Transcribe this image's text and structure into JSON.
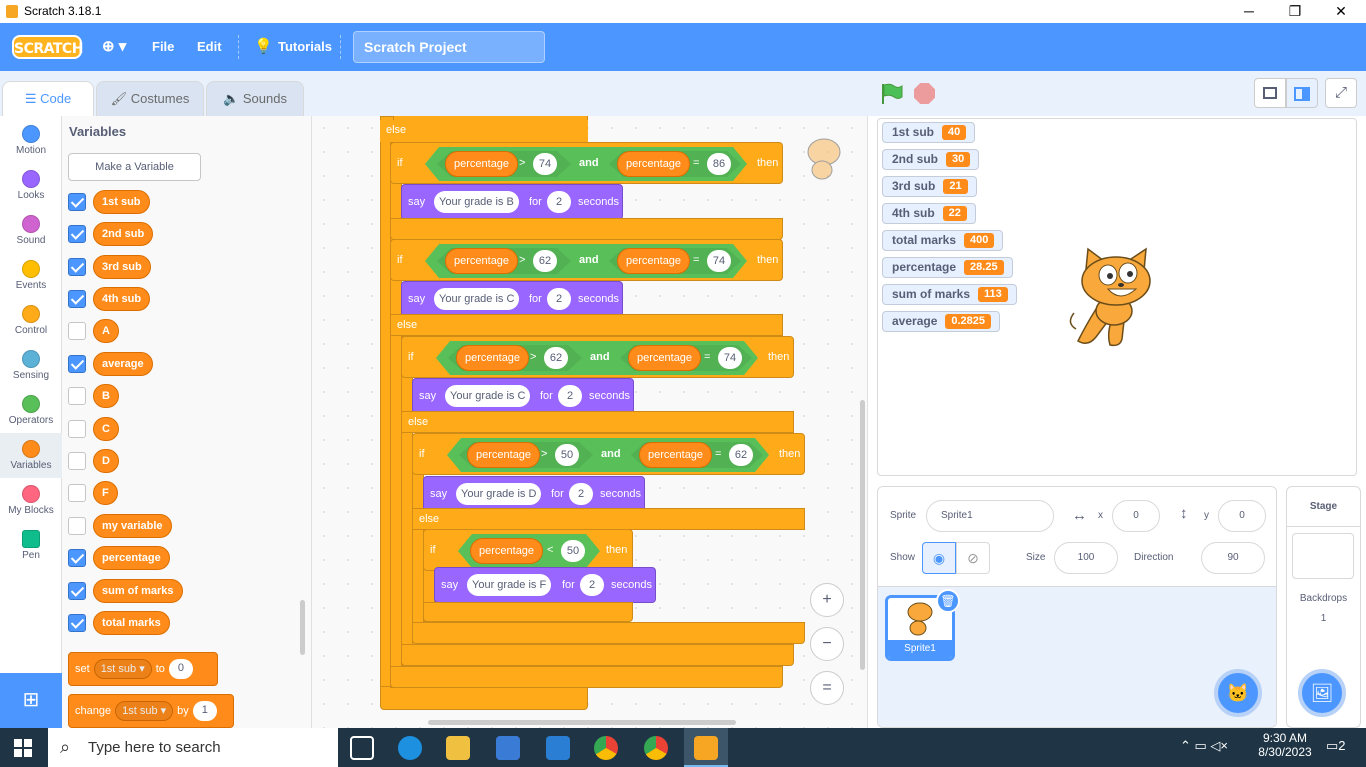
{
  "window": {
    "title": "Scratch 3.18.1",
    "min": "─",
    "max": "❐",
    "close": "✕"
  },
  "menu": {
    "logo": "SCRATCH",
    "language": "⊕ ▾",
    "file": "File",
    "edit": "Edit",
    "tutorials": "Tutorials",
    "project_title": "Scratch Project"
  },
  "tabs": [
    {
      "label": "Code",
      "icon": "code-icon"
    },
    {
      "label": "Costumes",
      "icon": "brush-icon"
    },
    {
      "label": "Sounds",
      "icon": "speaker-icon"
    }
  ],
  "categories": [
    {
      "label": "Motion",
      "color": "#4c97ff"
    },
    {
      "label": "Looks",
      "color": "#9966ff"
    },
    {
      "label": "Sound",
      "color": "#cf63cf"
    },
    {
      "label": "Events",
      "color": "#ffbf00"
    },
    {
      "label": "Control",
      "color": "#ffab19"
    },
    {
      "label": "Sensing",
      "color": "#5cb1d6"
    },
    {
      "label": "Operators",
      "color": "#59c059"
    },
    {
      "label": "Variables",
      "color": "#ff8c1a"
    },
    {
      "label": "My Blocks",
      "color": "#ff6680"
    },
    {
      "label": "Pen",
      "color": "#0fbd8c"
    }
  ],
  "palette": {
    "title": "Variables",
    "make_variable": "Make a Variable",
    "variables": [
      {
        "name": "1st sub",
        "checked": true
      },
      {
        "name": "2nd sub",
        "checked": true
      },
      {
        "name": "3rd sub",
        "checked": true
      },
      {
        "name": "4th sub",
        "checked": true
      },
      {
        "name": "A",
        "checked": false
      },
      {
        "name": "average",
        "checked": true
      },
      {
        "name": "B",
        "checked": false
      },
      {
        "name": "C",
        "checked": false
      },
      {
        "name": "D",
        "checked": false
      },
      {
        "name": "F",
        "checked": false
      },
      {
        "name": "my variable",
        "checked": false
      },
      {
        "name": "percentage",
        "checked": true
      },
      {
        "name": "sum of marks",
        "checked": true
      },
      {
        "name": "total marks",
        "checked": true
      }
    ],
    "set_block": {
      "kw": "set",
      "var": "1st sub ▾",
      "to": "to",
      "value": "0"
    },
    "change_block": {
      "kw": "change",
      "var": "1st sub ▾",
      "by": "by",
      "value": "1"
    }
  },
  "code": {
    "else_top": "else",
    "if1": {
      "kw": "if",
      "var1": "percentage",
      "op1": ">",
      "val1": "74",
      "and": "and",
      "var2": "percentage",
      "op2": "=",
      "val2": "86",
      "then": "then"
    },
    "say1": {
      "kw": "say",
      "text": "Your grade is B",
      "for": "for",
      "secs": "2",
      "seconds": "seconds"
    },
    "if2": {
      "kw": "if",
      "var1": "percentage",
      "op1": ">",
      "val1": "62",
      "and": "and",
      "var2": "percentage",
      "op2": "=",
      "val2": "74",
      "then": "then"
    },
    "say2": {
      "kw": "say",
      "text": "Your grade is C",
      "for": "for",
      "secs": "2",
      "seconds": "seconds"
    },
    "else2": "else",
    "if3": {
      "kw": "if",
      "var1": "percentage",
      "op1": ">",
      "val1": "62",
      "and": "and",
      "var2": "percentage",
      "op2": "=",
      "val2": "74",
      "then": "then"
    },
    "say3": {
      "kw": "say",
      "text": "Your grade is C",
      "for": "for",
      "secs": "2",
      "seconds": "seconds"
    },
    "else3": "else",
    "if4": {
      "kw": "if",
      "var1": "percentage",
      "op1": ">",
      "val1": "50",
      "and": "and",
      "var2": "percentage",
      "op2": "=",
      "val2": "62",
      "then": "then"
    },
    "say4": {
      "kw": "say",
      "text": "Your grade is D",
      "for": "for",
      "secs": "2",
      "seconds": "seconds"
    },
    "else4": "else",
    "if5": {
      "kw": "if",
      "var1": "percentage",
      "op1": "<",
      "val1": "50",
      "then": "then"
    },
    "say5": {
      "kw": "say",
      "text": "Your grade is F",
      "for": "for",
      "secs": "2",
      "seconds": "seconds"
    },
    "zoom_in": "+",
    "zoom_out": "−",
    "zoom_reset": "="
  },
  "monitors": [
    {
      "name": "1st sub",
      "value": "40"
    },
    {
      "name": "2nd sub",
      "value": "30"
    },
    {
      "name": "3rd sub",
      "value": "21"
    },
    {
      "name": "4th sub",
      "value": "22"
    },
    {
      "name": "total marks",
      "value": "400"
    },
    {
      "name": "percentage",
      "value": "28.25"
    },
    {
      "name": "sum of marks",
      "value": "113"
    },
    {
      "name": "average",
      "value": "0.2825"
    }
  ],
  "sprite": {
    "label": "Sprite",
    "name": "Sprite1",
    "x_label": "x",
    "x": "0",
    "y_label": "y",
    "y": "0",
    "show_label": "Show",
    "size_label": "Size",
    "size": "100",
    "direction_label": "Direction",
    "direction": "90",
    "thumb_name": "Sprite1"
  },
  "stage_pane": {
    "title": "Stage",
    "backdrops_label": "Backdrops",
    "backdrops_count": "1"
  },
  "taskbar": {
    "search": "Type here to search",
    "time": "9:30 AM",
    "date": "8/30/2023",
    "notifications": "2"
  }
}
